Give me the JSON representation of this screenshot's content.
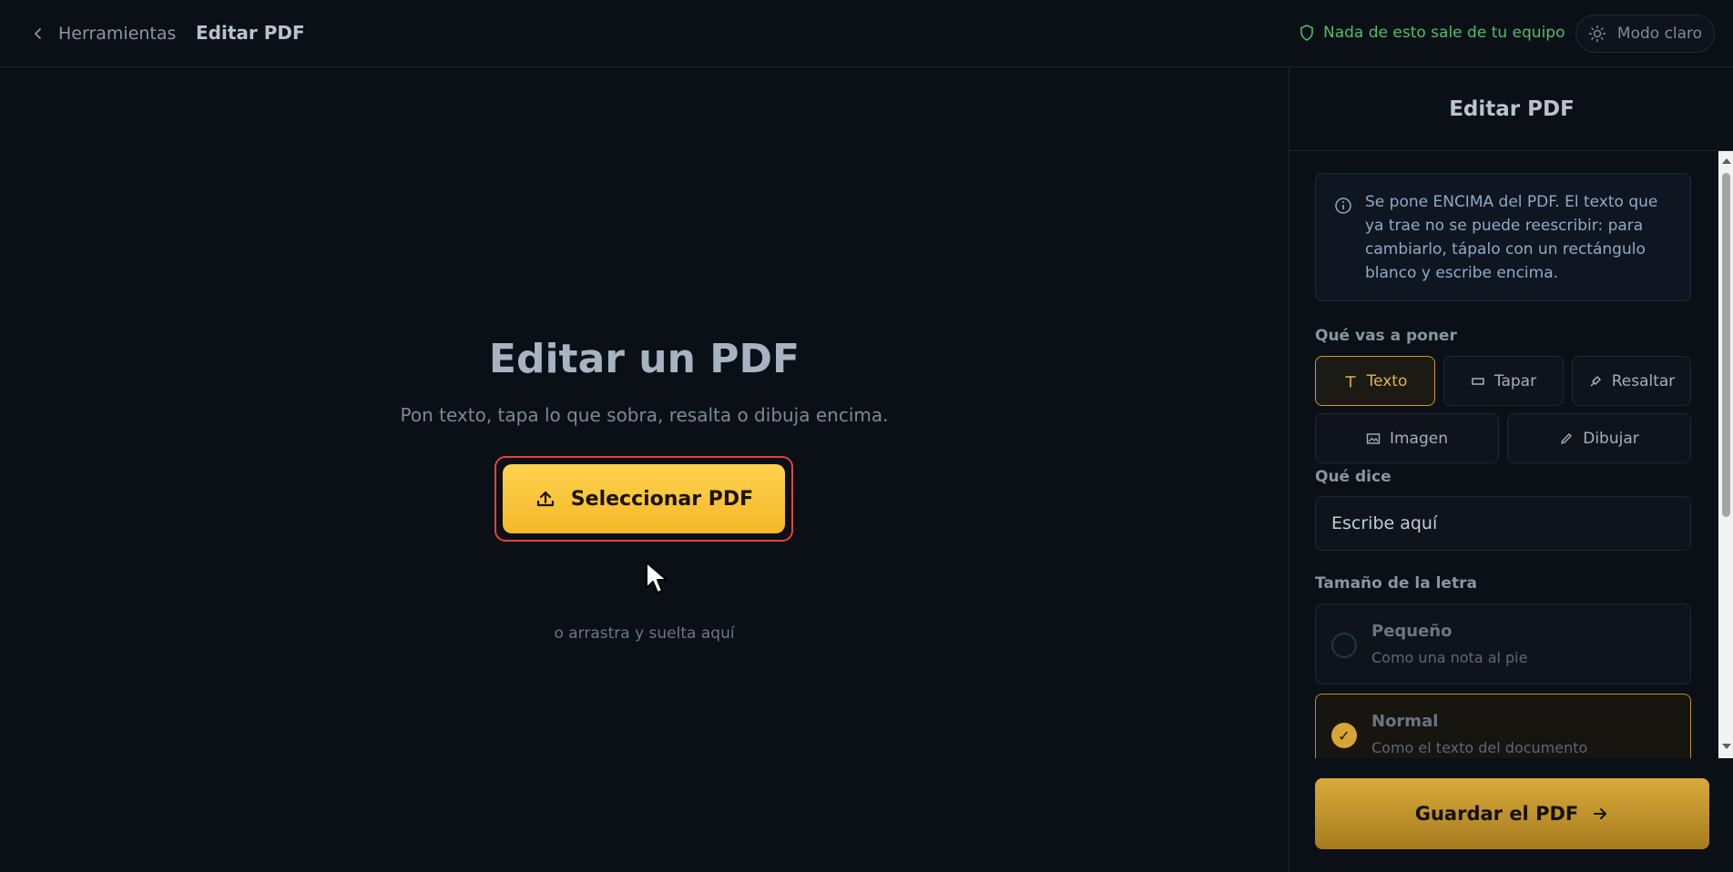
{
  "topbar": {
    "back_label": "Herramientas",
    "title": "Editar PDF",
    "privacy_text": "Nada de esto sale de tu equipo",
    "theme_label": "Modo claro"
  },
  "main": {
    "title": "Editar un PDF",
    "subtitle": "Pon texto, tapa lo que sobra, resalta o dibuja encima.",
    "select_button": "Seleccionar PDF",
    "drop_hint": "o arrastra y suelta aquí"
  },
  "sidebar": {
    "title": "Editar PDF",
    "info": "Se pone ENCIMA del PDF. El texto que ya trae no se puede reescribir: para cambiarlo, tápalo con un rectángulo blanco y escribe encima.",
    "what_label": "Qué vas a poner",
    "tools": [
      {
        "label": "Texto",
        "icon": "text-icon",
        "active": true
      },
      {
        "label": "Tapar",
        "icon": "rectangle-icon",
        "active": false
      },
      {
        "label": "Resaltar",
        "icon": "highlighter-icon",
        "active": false
      },
      {
        "label": "Imagen",
        "icon": "image-icon",
        "active": false
      },
      {
        "label": "Dibujar",
        "icon": "pencil-icon",
        "active": false
      }
    ],
    "says_label": "Qué dice",
    "text_value": "Escribe aquí",
    "size_label": "Tamaño de la letra",
    "sizes": [
      {
        "title": "Pequeño",
        "desc": "Como una nota al pie",
        "selected": false
      },
      {
        "title": "Normal",
        "desc": "Como el texto del documento",
        "selected": true
      }
    ],
    "save_button": "Guardar el PDF"
  },
  "colors": {
    "accent": "#f4b82a",
    "privacy_green": "#4fbf6b",
    "highlight_border": "#e3433a"
  }
}
